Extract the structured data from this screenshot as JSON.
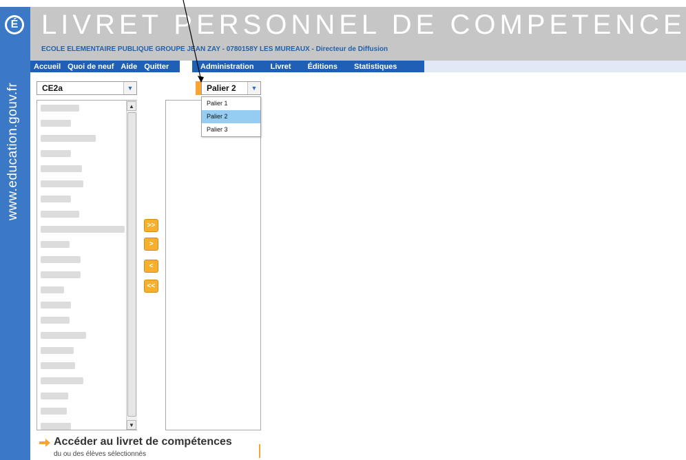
{
  "sidebar": {
    "logo_letter": "É",
    "url": "www.education.gouv.fr"
  },
  "header": {
    "title": "LIVRET PERSONNEL DE COMPETENCES",
    "school_line": "ECOLE ELEMENTAIRE PUBLIQUE GROUPE JEAN ZAY - 0780158Y LES MUREAUX - Directeur de Diffusion"
  },
  "nav": {
    "left": [
      "Accueil",
      "Quoi de neuf",
      "Aide",
      "Quitter"
    ],
    "right": [
      "Administration",
      "Livret",
      "Éditions",
      "Statistiques"
    ]
  },
  "class_select": {
    "value": "CE2a"
  },
  "palier_select": {
    "value": "Palier 2",
    "options": [
      "Palier 1",
      "Palier 2",
      "Palier 3"
    ],
    "selected_index": 1
  },
  "move_buttons": [
    ">>",
    ">",
    "<",
    "<<"
  ],
  "access": {
    "title": "Accéder au livret de compétences",
    "subtitle": "du ou des élèves sélectionnés"
  },
  "colors": {
    "brand_blue": "#1f5fb5",
    "accent_orange": "#f7b02e",
    "selection_blue": "#95ccf1"
  }
}
